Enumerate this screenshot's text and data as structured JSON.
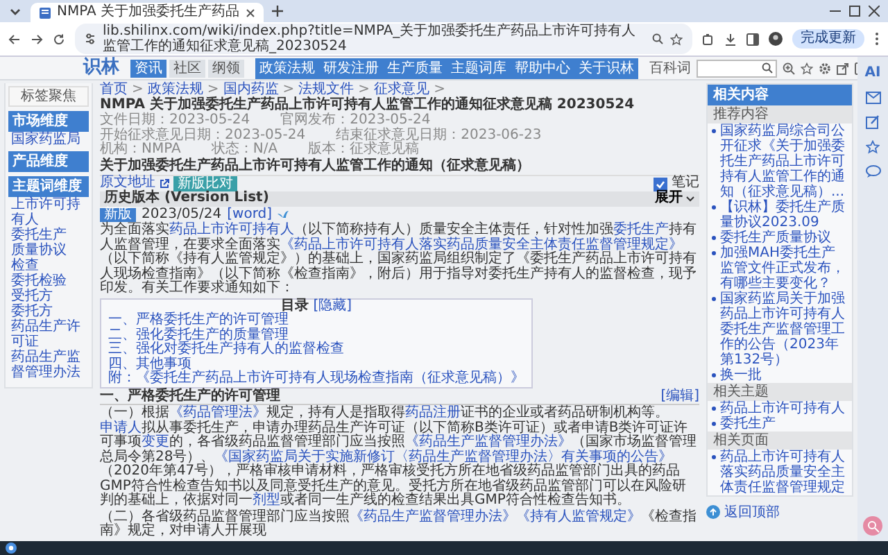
{
  "browser": {
    "tab_title": "NMPA 关于加强委托生产药品",
    "url": "lib.shilinx.com/wiki/index.php?title=NMPA_关于加强委托生产药品上市许可持有人监管工作的通知征求意见稿_20230524",
    "profile_button": "完成更新"
  },
  "header": {
    "logo": "识林",
    "tabs": [
      {
        "label": "资讯",
        "selected": true
      },
      {
        "label": "社区",
        "selected": false
      },
      {
        "label": "纲领",
        "selected": false
      }
    ],
    "nav": [
      "政策法规",
      "研发注册",
      "生产质量",
      "主题词库",
      "帮助中心",
      "关于识林"
    ],
    "search_label": "百科词"
  },
  "left_sidebar": {
    "focus_button": "标签聚焦",
    "groups": [
      {
        "title": "市场维度",
        "items": [
          "国家药监局"
        ]
      },
      {
        "title": "产品维度"
      },
      {
        "title": "主题词维度",
        "items": [
          "上市许可持有人",
          "委托生产",
          "质量协议",
          "检查",
          "委托检验",
          "受托方",
          "委托方",
          "药品生产许可证",
          "药品生产监督管理办法"
        ]
      }
    ]
  },
  "breadcrumb": {
    "separator": ">",
    "links": [
      "首页",
      "政策法规",
      "国内药监",
      "法规文件",
      "征求意见"
    ],
    "current": "NMPA 关于加强委托生产药品上市许可持有人监管工作的通知征求意见稿 20230524"
  },
  "meta": [
    [
      "文件日期：2023-05-24",
      "官网发布：2023-05-24"
    ],
    [
      "开始征求意见日期：2023-05-24",
      "结束征求意见日期：2023-06-23"
    ],
    [
      "机构：NMPA",
      "状态：N/A",
      "版本：征求意见稿"
    ]
  ],
  "title": "关于加强委托生产药品上市许可持有人监管工作的通知（征求意见稿）",
  "source_link": "原文地址",
  "compare_button": "新版比对",
  "note": {
    "label": "笔记",
    "checked": true
  },
  "history": {
    "title": "历史版本 (Version List)",
    "toggle": "展开"
  },
  "version": {
    "tag": "新版",
    "date": "2023/05/24",
    "format": "[word]"
  },
  "intro": [
    {
      "text": "为全面落实",
      "link": false
    },
    {
      "text": "药品上市许可持有人",
      "link": true
    },
    {
      "text": "（以下简称持有人）质量安全主体责任，针对性加强",
      "link": false
    },
    {
      "text": "委托生产",
      "link": true
    },
    {
      "text": "持有人监督管理，在要求全面落实",
      "link": false
    },
    {
      "text": "《药品上市许可持有人落实药品质量安全主体责任监督管理规定》",
      "link": true
    },
    {
      "text": "（以下简称《持有人监管规定》）的基础上，国家药监局组织制定了《委托生产药品上市许可持有人现场检查指南》（以下简称《检查指南》，附后）用于指导对委托生产持有人的监督检查，现予印发。有关工作要求通知如下：",
      "link": false
    }
  ],
  "toc": {
    "title": "目录",
    "toggle": "[隐藏]",
    "items": [
      "一、严格委托生产的许可管理",
      "二、强化委托生产的质量管理",
      "三、强化对委托生产持有人的监督检查",
      "四、其他事项",
      "附：《委托生产药品上市许可持有人现场检查指南（征求意见稿）》"
    ]
  },
  "section": {
    "heading": "一、严格委托生产的许可管理",
    "edit": "[编辑]",
    "paragraphs": [
      [
        {
          "text": "（一）根据",
          "link": false
        },
        {
          "text": "《药品管理法》",
          "link": true
        },
        {
          "text": "规定，持有人是指取得",
          "link": false
        },
        {
          "text": "药品注册",
          "link": true
        },
        {
          "text": "证书的企业或者药品研制机构等。",
          "link": false
        },
        {
          "text": "申请人",
          "link": true
        },
        {
          "text": "拟从事委托生产，申请办理药品生产许可证（以下简称B类许可证）或者申请B类许可证许可事项",
          "link": false
        },
        {
          "text": "变更",
          "link": true
        },
        {
          "text": "的，各省级药品监督管理部门应当按照",
          "link": false
        },
        {
          "text": "《药品生产监督管理办法》",
          "link": true
        },
        {
          "text": "（国家市场监督管理总局令第28号）、",
          "link": false
        },
        {
          "text": "《国家药监局关于实施新修订〈药品生产监督管理办法〉有关事项的公告》",
          "link": true
        },
        {
          "text": "（2020年第47号），严格审核申请材料，严格审核受托方所在地省级药品监管部门出具的药品GMP符合性检查告知书以及同意受托生产的意见。受托方所在地省级药品监管部门可以在风险研判的基础上，依据对同一",
          "link": false
        },
        {
          "text": "剂型",
          "link": true
        },
        {
          "text": "或者同一生产线的检查结果出具GMP符合性检查告知书。",
          "link": false
        }
      ],
      [
        {
          "text": "（二）各省级药品监督管理部门应当按照",
          "link": false
        },
        {
          "text": "《药品生产监督管理办法》",
          "link": true
        },
        {
          "text": "《持有人监管规定》",
          "link": true
        },
        {
          "text": "《检查指南》规定，对申请人开展现",
          "link": false
        }
      ]
    ]
  },
  "right_sidebar": {
    "title": "相关内容",
    "sections": [
      {
        "title": "推荐内容",
        "items": [
          "国家药监局综合司公开征求《关于加强委托生产药品上市许可持有人监管工作的通知（征求意见稿）...",
          "【识林】委托生产质量协议2023.09",
          "委托生产质量协议",
          "加强MAH委托生产监管文件正式发布，有哪些主要变化？",
          "国家药监局关于加强药品上市许可持有人委托生产监督管理工作的公告（2023年第132号）"
        ],
        "more": "换一批"
      },
      {
        "title": "相关主题",
        "items": [
          "药品上市许可持有人",
          "委托生产"
        ]
      },
      {
        "title": "相关页面",
        "items": [
          "药品上市许可持有人落实药品质量安全主体责任监督管理规定"
        ]
      }
    ],
    "back_to_top": "返回顶部"
  },
  "side_tools": {
    "ai": "AI"
  }
}
